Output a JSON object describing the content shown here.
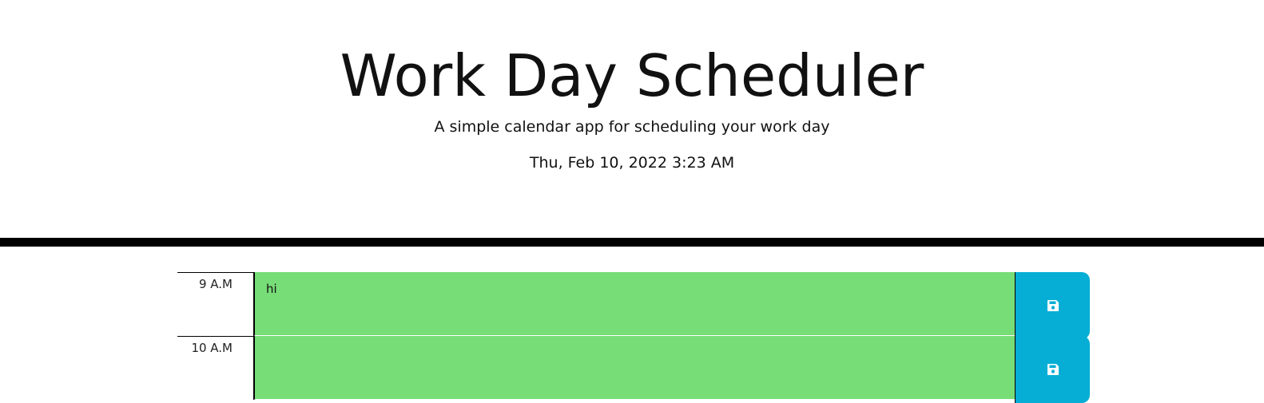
{
  "header": {
    "title": "Work Day Scheduler",
    "subtitle": "A simple calendar app for scheduling your work day",
    "current_date": "Thu, Feb 10, 2022 3:23 AM"
  },
  "time_blocks": [
    {
      "hour": "9 A.M",
      "text": "hi",
      "status": "future",
      "save_icon": "floppy-disk-icon"
    },
    {
      "hour": "10 A.M",
      "text": "",
      "status": "future",
      "save_icon": "floppy-disk-icon"
    }
  ],
  "colors": {
    "future": "#77dd77",
    "save_button": "#06aed5",
    "divider": "#000000"
  }
}
